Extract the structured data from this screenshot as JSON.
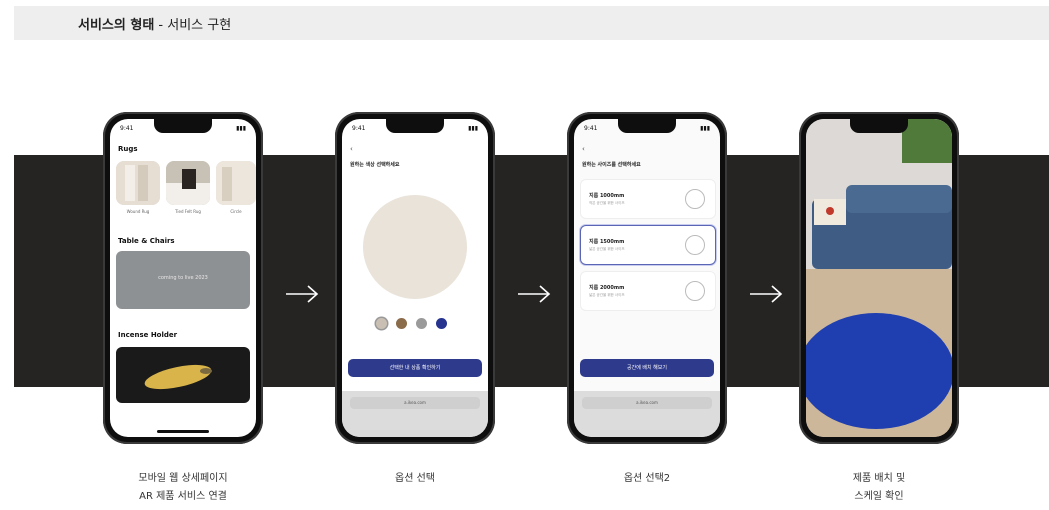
{
  "header": {
    "title_bold": "서비스의 형태",
    "title_rest": " - 서비스 구현"
  },
  "colors": {
    "band": "#262323",
    "accent": "#2e3a8c",
    "rug_blue": "#1f3fb0"
  },
  "phones": {
    "p1": {
      "time": "9:41",
      "section_rugs": "Rugs",
      "thumb_labels": [
        "Wound Rug",
        "Tied Felt Rug",
        "Circle"
      ],
      "section_tables": "Table & Chairs",
      "banner_text": "coming to live 2023",
      "section_incense": "Incense Holder"
    },
    "p2": {
      "time": "9:41",
      "heading": "원하는 색상 선택하세요",
      "swatch_colors": [
        "#c9c0b3",
        "#8a6b4a",
        "#9a9a9a",
        "#26338f"
      ],
      "cta_label": "선택한 내 상품 확인하기",
      "url": "a.ikea.com"
    },
    "p3": {
      "time": "9:41",
      "heading": "원하는 사이즈를 선택하세요",
      "options": [
        {
          "title": "지름 1000mm",
          "sub": "작은 공간을 위한 사이즈"
        },
        {
          "title": "지름 1500mm",
          "sub": "넓은 공간을 위한 사이즈"
        },
        {
          "title": "지름 2000mm",
          "sub": "넓은 공간을 위한 사이즈"
        }
      ],
      "cta_label": "공간에 배치 해보기",
      "url": "a.ikea.com"
    }
  },
  "captions": [
    {
      "line1": "모바일 웹 상세페이지",
      "line2": "AR 제품 서비스 연결"
    },
    {
      "line1": "옵션 선택",
      "line2": ""
    },
    {
      "line1": "옵션 선택2",
      "line2": ""
    },
    {
      "line1": "제품 배치 및",
      "line2": "스케일 확인"
    }
  ]
}
